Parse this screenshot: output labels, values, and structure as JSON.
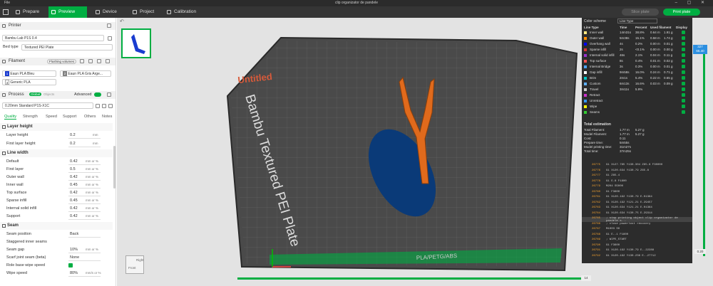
{
  "titlebar": {
    "file": "File",
    "title": "clip organizator de pandele"
  },
  "nav": {
    "tabs": [
      {
        "label": "Prepare",
        "active": false
      },
      {
        "label": "Preview",
        "active": true
      },
      {
        "label": "Device",
        "active": false
      },
      {
        "label": "Project",
        "active": false
      },
      {
        "label": "Calibration",
        "active": false
      }
    ],
    "slice_label": "Slice plate",
    "print_label": "Print plate"
  },
  "printer": {
    "header": "Printer",
    "name": "Bambu Lab P1S 0.4",
    "bed_type_label": "Bed type",
    "bed_type": "Textured PEI Plate"
  },
  "filament": {
    "header": "Filament",
    "flushing_label": "Flushing volumes",
    "slots": [
      {
        "num": "1",
        "name": "Eaun PLA Bleu",
        "color": "#1a3cd0"
      },
      {
        "num": "2",
        "name": "Eaun PLA Gris Arge...",
        "color": "#808080"
      },
      {
        "num": "3",
        "name": "Generic PLA",
        "color": "#ffffff"
      }
    ]
  },
  "process": {
    "header": "Process",
    "global_label": "Global",
    "objects_label": "Objects",
    "advanced_label": "Advanced",
    "preset": "0.20mm Standard P1S-X1C",
    "tabs": [
      "Quality",
      "Strength",
      "Speed",
      "Support",
      "Others",
      "Notes"
    ]
  },
  "quality": {
    "layer_height_group": "Layer height",
    "layer_height": {
      "label": "Layer height",
      "value": "0.2",
      "unit": "mm"
    },
    "first_layer_height": {
      "label": "First layer height",
      "value": "0.2",
      "unit": "mm"
    },
    "line_width_group": "Line width",
    "line_widths": [
      {
        "label": "Default",
        "value": "0.42",
        "unit": "mm or %"
      },
      {
        "label": "First layer",
        "value": "0.5",
        "unit": "mm or %"
      },
      {
        "label": "Outer wall",
        "value": "0.42",
        "unit": "mm or %"
      },
      {
        "label": "Inner wall",
        "value": "0.45",
        "unit": "mm or %"
      },
      {
        "label": "Top surface",
        "value": "0.42",
        "unit": "mm or %"
      },
      {
        "label": "Sparse infill",
        "value": "0.45",
        "unit": "mm or %"
      },
      {
        "label": "Internal solid infill",
        "value": "0.42",
        "unit": "mm or %"
      },
      {
        "label": "Support",
        "value": "0.42",
        "unit": "mm or %"
      }
    ],
    "seam_group": "Seam",
    "seam_position": {
      "label": "Seam position",
      "value": "Back"
    },
    "staggered": {
      "label": "Staggered inner seams"
    },
    "seam_gap": {
      "label": "Seam gap",
      "value": "10%",
      "unit": "mm or %"
    },
    "scarf": {
      "label": "Scarf joint seam (beta)",
      "value": "None"
    },
    "role_base": {
      "label": "Role base wipe speed"
    },
    "wipe_speed": {
      "label": "Wipe speed",
      "value": "80%",
      "unit": "mm/s or %"
    }
  },
  "scene": {
    "plate_text": "Bambu Textured PEI Plate",
    "untitled": "Untitled",
    "plate_code": "PLA/PETG/ABS",
    "cube_top": "Front",
    "cube_side": "Right"
  },
  "color_scheme": {
    "header": "Color scheme",
    "dropdown": "Line Type",
    "cols": [
      "Line Type",
      "Time",
      "Percent",
      "Used filament",
      "Display"
    ],
    "rows": [
      {
        "color": "#ffe680",
        "name": "Inner wall",
        "time": "14m31s",
        "pct": "38.8%",
        "len": "0.64 m",
        "g": "1.91 g"
      },
      {
        "color": "#ff8c00",
        "name": "Outer wall",
        "time": "5m38s",
        "pct": "15.1%",
        "len": "0.58 m",
        "g": "1.74 g"
      },
      {
        "color": "#0000ff",
        "name": "Overhang wall",
        "time": "4s",
        "pct": "0.2%",
        "len": "0.00 m",
        "g": "0.01 g"
      },
      {
        "color": "#d93636",
        "name": "Sparse infill",
        "time": "2s",
        "pct": "<0.1%",
        "len": "0.00 m",
        "g": "0.00 g"
      },
      {
        "color": "#9933cc",
        "name": "Internal solid infill",
        "time": "46s",
        "pct": "2.1%",
        "len": "0.04 m",
        "g": "0.11 g"
      },
      {
        "color": "#ff5252",
        "name": "Top surface",
        "time": "8s",
        "pct": "0.4%",
        "len": "0.01 m",
        "g": "0.02 g"
      },
      {
        "color": "#4da6ff",
        "name": "Internal Bridge",
        "time": "3s",
        "pct": "0.3%",
        "len": "0.00 m",
        "g": "0.01 g"
      },
      {
        "color": "#ffffff",
        "name": "Gap infill",
        "time": "9m58s",
        "pct": "16.0%",
        "len": "0.24 m",
        "g": "0.71 g"
      },
      {
        "color": "#00c8c8",
        "name": "Brim",
        "time": "2m1s",
        "pct": "5.4%",
        "len": "0.22 m",
        "g": "0.65 g"
      },
      {
        "color": "#5eb0ff",
        "name": "Custom",
        "time": "6m13s",
        "pct": "16.6%",
        "len": "0.03 m",
        "g": "0.09 g"
      },
      {
        "color": "#cccccc",
        "name": "Travel",
        "time": "3m11s",
        "pct": "5.9%",
        "len": "",
        "g": ""
      },
      {
        "color": "#cc33cc",
        "name": "Retract",
        "time": "",
        "pct": "",
        "len": "",
        "g": ""
      },
      {
        "color": "#3399ff",
        "name": "Unretract",
        "time": "",
        "pct": "",
        "len": "",
        "g": ""
      },
      {
        "color": "#ffff00",
        "name": "Wipe",
        "time": "",
        "pct": "",
        "len": "",
        "g": ""
      },
      {
        "color": "#33cc33",
        "name": "Seams",
        "time": "",
        "pct": "",
        "len": "",
        "g": ""
      }
    ],
    "total_header": "Total estimation",
    "totals": [
      {
        "k": "Total Filament:",
        "v": "1.77 m",
        "v2": "5.27 g"
      },
      {
        "k": "Model Filament:",
        "v": "1.77 m",
        "v2": "5.27 g"
      },
      {
        "k": "Cost:",
        "v": "0.11",
        "v2": ""
      },
      {
        "k": "Prepare time:",
        "v": "5m55s",
        "v2": ""
      },
      {
        "k": "Model printing time:",
        "v": "31m27s",
        "v2": ""
      },
      {
        "k": "Total time:",
        "v": "37m25s",
        "v2": ""
      }
    ]
  },
  "gcode": [
    {
      "n": "26775",
      "c": "G1 X127.785 Y130.304 Z65.8 F30000"
    },
    {
      "n": "26776",
      "c": "G1 X120.634 Y130.79 Z65.8"
    },
    {
      "n": "26777",
      "c": "G1 Z65.4"
    },
    {
      "n": "26778",
      "c": "G1 E.8 F1800"
    },
    {
      "n": "26779",
      "c": "M204 S5000"
    },
    {
      "n": "26780",
      "c": "G1 F3600"
    },
    {
      "n": "26781",
      "c": "G1 X120.192 Y130.79 E.01364"
    },
    {
      "n": "26782",
      "c": "G1 X120.192 Y121.21 E.29457"
    },
    {
      "n": "26783",
      "c": "G1 X120.634 Y121.21 E.01364"
    },
    {
      "n": "26784",
      "c": "G1 X120.634 Y130.75 E.29314"
    },
    {
      "n": "26785",
      "c": "; stop printing object clip organizator de pandele.s..."
    },
    {
      "n": "26786",
      "c": "; close powerlost recovery"
    },
    {
      "n": "26787",
      "c": "M1003 S0"
    },
    {
      "n": "26788",
      "c": "G1 E-.1 F1800"
    },
    {
      "n": "26789",
      "c": "; WIPE_START"
    },
    {
      "n": "26790",
      "c": "G1 F3600"
    },
    {
      "n": "26791",
      "c": "G1 X120.192 Y130.79 E-.22288"
    },
    {
      "n": "26792",
      "c": "G1 X120.192 Y130.236 E-.27712"
    }
  ],
  "layer_slider": {
    "top_value": "327",
    "top_height": "65.40",
    "bottom_value": "1",
    "bottom_height": "0.20"
  },
  "move_slider": {
    "value": "14"
  }
}
